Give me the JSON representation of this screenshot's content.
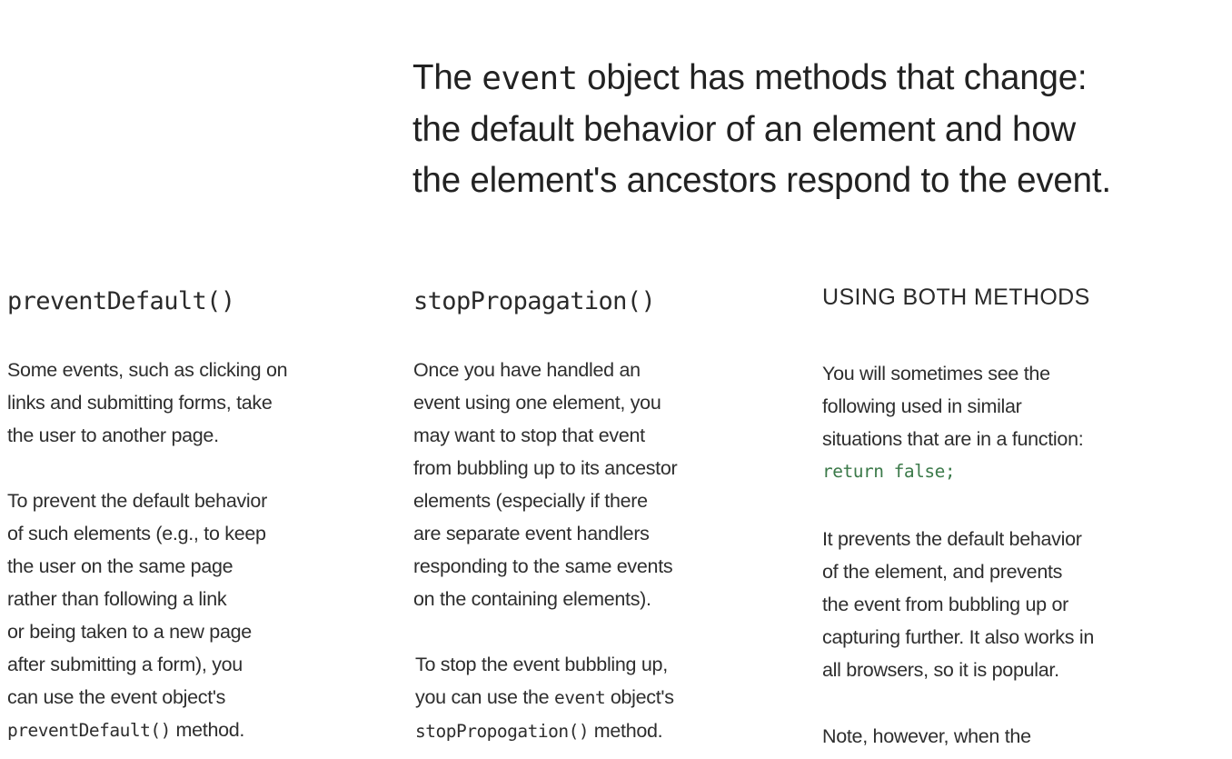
{
  "headline": {
    "line1_pre": "The ",
    "line1_code": "event",
    "line1_post": " object has methods that change:",
    "line2": "the default behavior of an element and how",
    "line3": "the element's ancestors respond to the event."
  },
  "col1": {
    "title": "preventDefault()",
    "p1": [
      "Some events, such as clicking on",
      "links and submitting forms, take",
      "the user to another page."
    ],
    "p2": [
      "To prevent the default behavior",
      "of such elements (e.g., to keep",
      "the user on the same page",
      "rather than following a link",
      "or being taken to a new page",
      "after submitting a form), you",
      "can use the event object's"
    ],
    "p2_last_code": "preventDefault()",
    "p2_last_post": " method."
  },
  "col2": {
    "title": "stopPropagation()",
    "p1": [
      "Once you have handled an",
      "event using one element, you",
      "may want to stop that event",
      "from bubbling up to its ancestor",
      "elements (especially if there",
      "are separate event handlers",
      "responding to the same events",
      "on the containing elements)."
    ],
    "p2_line1": "To stop the event bubbling up,",
    "p2_line2_pre": "you can use the ",
    "p2_line2_code": "event",
    "p2_line2_post": " object's",
    "p2_line3_code": "stopPropogation()",
    "p2_line3_post": " method."
  },
  "col3": {
    "title": "USING BOTH METHODS",
    "p1": [
      "You will sometimes see the",
      "following used in similar",
      "situations that are in a function:"
    ],
    "p1_code": "return false;",
    "p2": [
      "It prevents the default behavior",
      "of the element, and prevents",
      "the event from bubbling up or",
      "capturing further. It also works in",
      "all browsers, so it is popular."
    ],
    "p3": [
      "Note, however, when the"
    ]
  },
  "colors": {
    "text": "#2b2b2b",
    "code_accent": "#3c7a4a"
  }
}
